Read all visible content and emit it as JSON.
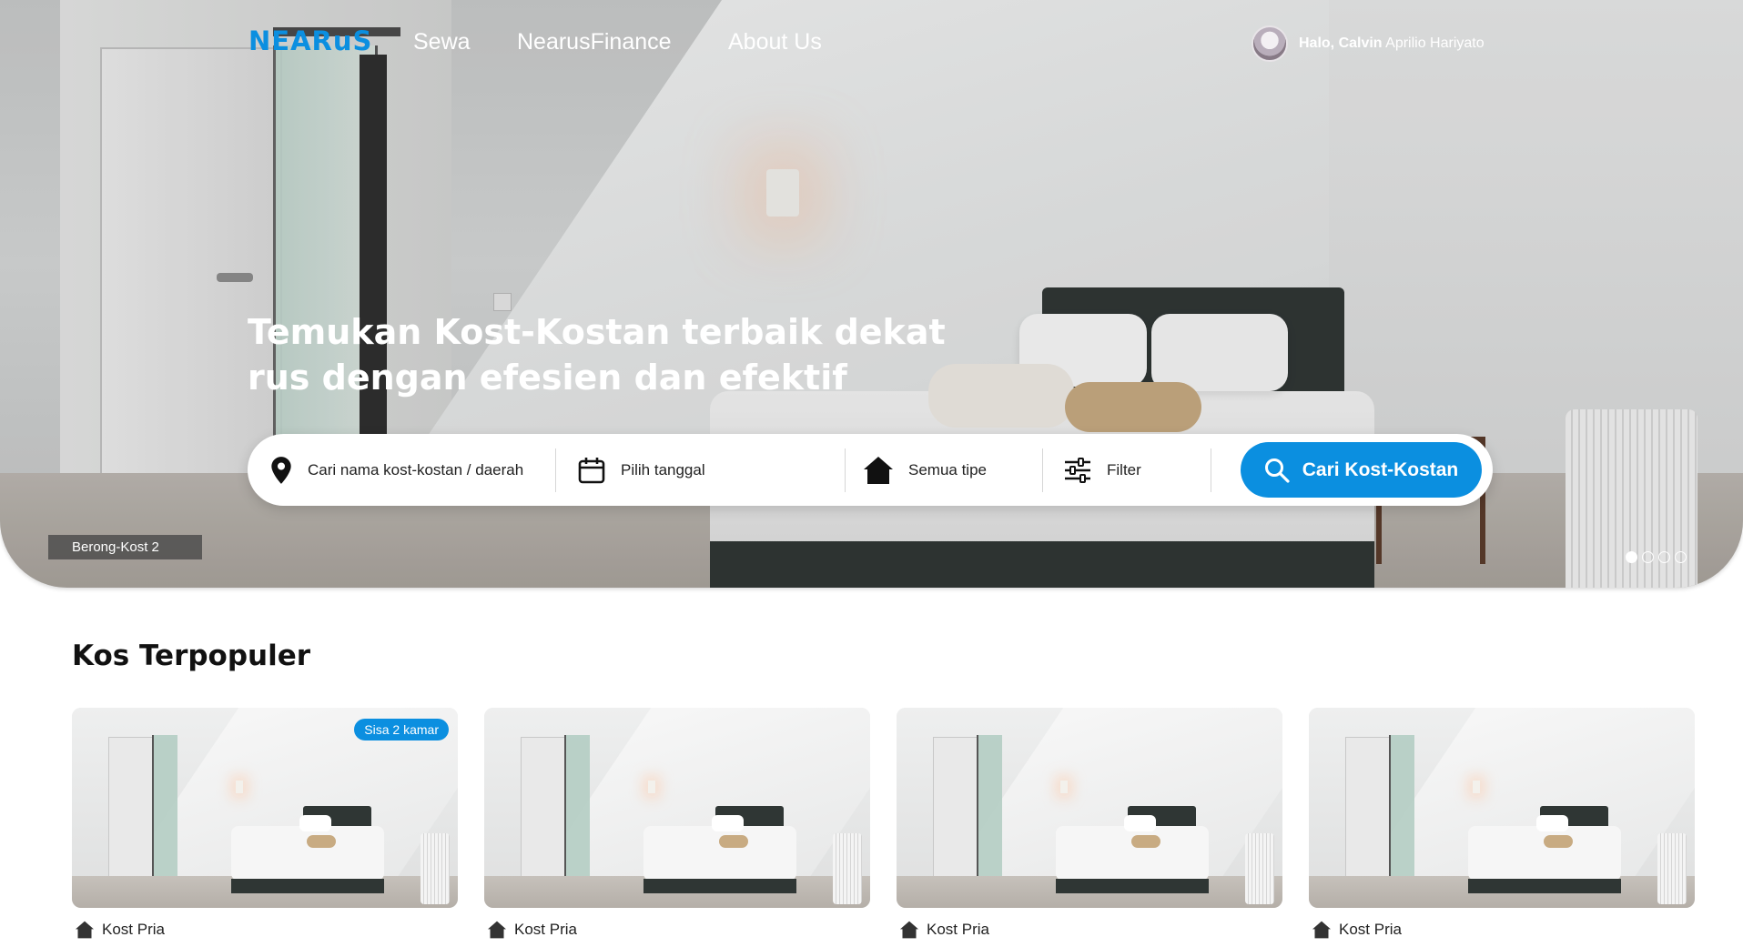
{
  "nav": {
    "logo": "NEARuS",
    "links": [
      "Sewa",
      "NearusFinance",
      "About Us"
    ],
    "greeting_bold": "Halo, Calvin",
    "greeting_rest": "Aprilio Hariyato"
  },
  "hero": {
    "headline_line1": "Temukan Kost-Kostan terbaik dekat",
    "headline_line2": "rus dengan efesien dan efektif",
    "caption": "Berong-Kost 2",
    "slide_count": 4,
    "active_slide": 1
  },
  "search": {
    "location_label": "Cari nama kost-kostan / daerah",
    "date_label": "Pilih tanggal",
    "type_label": "Semua tipe",
    "filter_label": "Filter",
    "button_label": "Cari Kost-Kostan"
  },
  "popular": {
    "title": "Kos Terpopuler",
    "cards": [
      {
        "type": "Kost Pria",
        "badge": "Sisa 2 kamar"
      },
      {
        "type": "Kost Pria",
        "badge": ""
      },
      {
        "type": "Kost Pria",
        "badge": ""
      },
      {
        "type": "Kost Pria",
        "badge": ""
      }
    ]
  },
  "colors": {
    "accent": "#0b8fe0",
    "text": "#111111"
  },
  "icons": {
    "location": "location-pin-icon",
    "date": "calendar-icon",
    "type": "house-icon",
    "filter": "sliders-icon",
    "search": "search-icon"
  }
}
